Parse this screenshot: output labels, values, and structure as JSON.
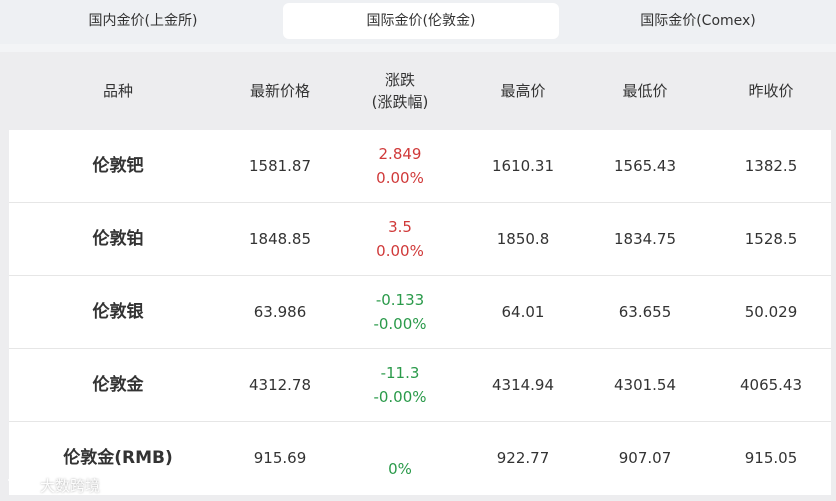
{
  "tabs": [
    {
      "label": "国内金价(上金所)",
      "active": false
    },
    {
      "label": "国际金价(伦敦金)",
      "active": true
    },
    {
      "label": "国际金价(Comex)",
      "active": false
    }
  ],
  "table": {
    "headers": {
      "name": "品种",
      "latest": "最新价格",
      "change_line1": "涨跌",
      "change_line2": "(涨跌幅)",
      "high": "最高价",
      "low": "最低价",
      "prev_close": "昨收价"
    },
    "rows": [
      {
        "name": "伦敦钯",
        "latest": "1581.87",
        "change": "2.849",
        "change_pct": "0.00%",
        "high": "1610.31",
        "low": "1565.43",
        "prev_close": "1382.5",
        "trend": "up"
      },
      {
        "name": "伦敦铂",
        "latest": "1848.85",
        "change": "3.5",
        "change_pct": "0.00%",
        "high": "1850.8",
        "low": "1834.75",
        "prev_close": "1528.5",
        "trend": "up"
      },
      {
        "name": "伦敦银",
        "latest": "63.986",
        "change": "-0.133",
        "change_pct": "-0.00%",
        "high": "64.01",
        "low": "63.655",
        "prev_close": "50.029",
        "trend": "down"
      },
      {
        "name": "伦敦金",
        "latest": "4312.78",
        "change": "-11.3",
        "change_pct": "-0.00%",
        "high": "4314.94",
        "low": "4301.54",
        "prev_close": "4065.43",
        "trend": "down"
      },
      {
        "name": "伦敦金(RMB)",
        "latest": "915.69",
        "change": "",
        "change_pct": "0%",
        "high": "922.77",
        "low": "907.07",
        "prev_close": "915.05",
        "trend": "flat"
      }
    ]
  },
  "watermark": {
    "text": "大数跨境",
    "icon": "brand-logo-icon"
  },
  "colors": {
    "up": "#d03a3a",
    "down": "#2a9a4a",
    "active_tab_bg": "#ffffff"
  }
}
